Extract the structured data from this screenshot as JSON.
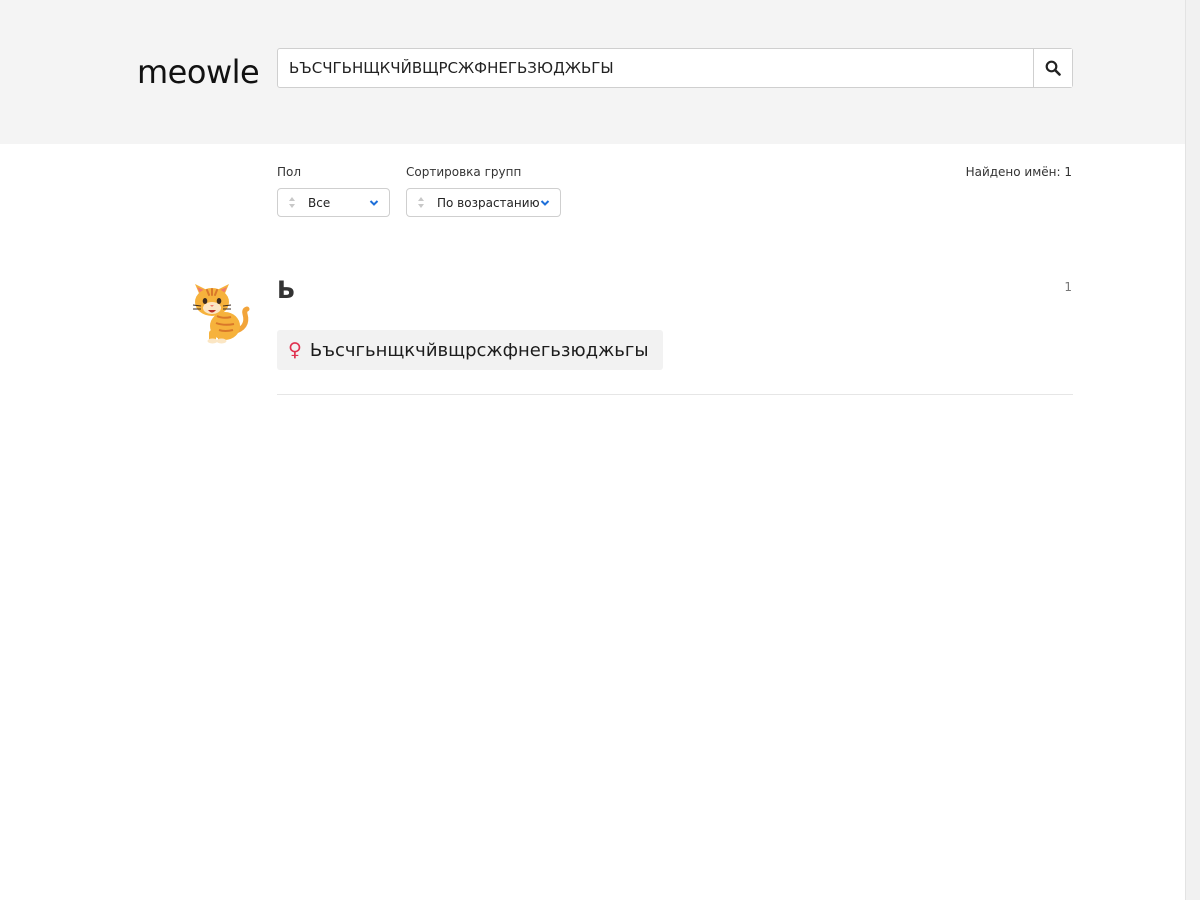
{
  "header": {
    "logo": "meowle",
    "search": {
      "value": "ЬЪСЧГЬНЩКЧЙВЩРСЖФНЕГЬЗЮДЖЬГЫ",
      "icon": "search-icon"
    }
  },
  "filters": {
    "gender": {
      "label": "Пол",
      "selected": "Все"
    },
    "sort": {
      "label": "Сортировка групп",
      "selected": "По возрастанию"
    },
    "found": "Найдено имён: 1"
  },
  "groups": [
    {
      "letter": "Ь",
      "count": "1",
      "names": [
        {
          "gender_symbol": "♀",
          "gender_color": "#e0314f",
          "name": "Ьъсчгьнщкчйвщрсжфнегьзюджьгы"
        }
      ]
    }
  ],
  "colors": {
    "header_bg": "#f4f4f4",
    "accent": "#1e6fd9",
    "female": "#e0314f"
  }
}
